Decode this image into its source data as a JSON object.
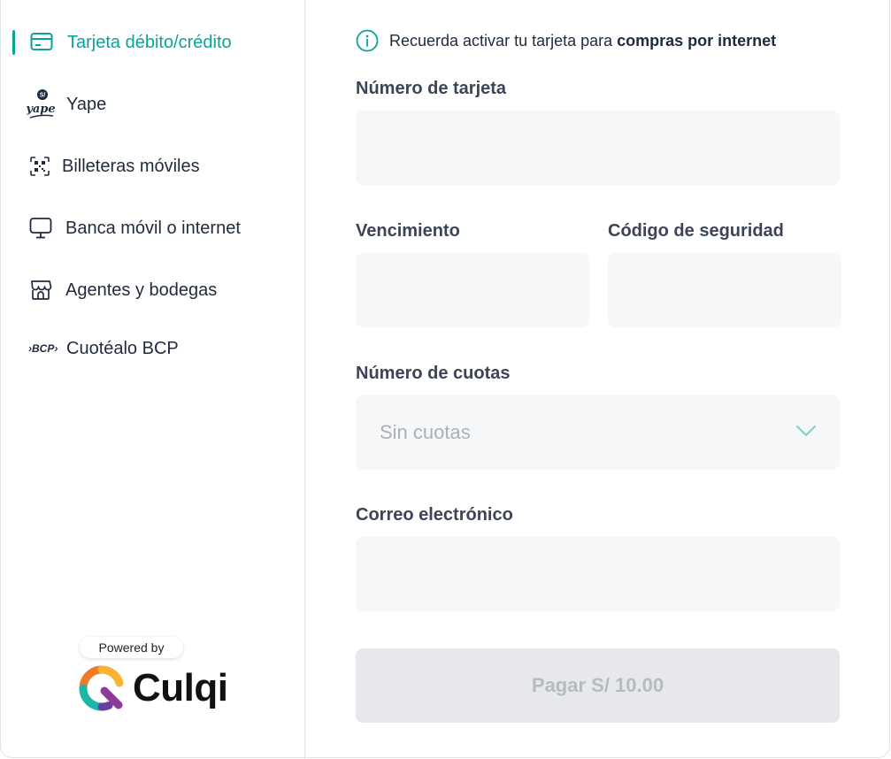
{
  "sidebar": {
    "items": [
      {
        "label": "Tarjeta débito/crédito",
        "icon": "credit-card-icon",
        "active": true
      },
      {
        "label": "Yape",
        "icon": "yape-logo-icon"
      },
      {
        "label": "Billeteras móviles",
        "icon": "qr-code-icon"
      },
      {
        "label": "Banca móvil o internet",
        "icon": "monitor-icon"
      },
      {
        "label": "Agentes y bodegas",
        "icon": "store-icon"
      },
      {
        "label": "Cuotéalo BCP",
        "icon": "bcp-logo-icon",
        "logo_text": "›BCP›"
      }
    ],
    "powered_by": "Powered by",
    "brand": "Culqi"
  },
  "form": {
    "notice_text": "Recuerda activar tu tarjeta para",
    "notice_strong": "compras por internet",
    "card_number_label": "Número de tarjeta",
    "card_number_value": "",
    "expiry_label": "Vencimiento",
    "expiry_value": "",
    "cvv_label": "Código de seguridad",
    "cvv_value": "",
    "installments_label": "Número de cuotas",
    "installments_value": "Sin cuotas",
    "email_label": "Correo electrónico",
    "email_value": "",
    "pay_button": "Pagar S/ 10.00"
  },
  "colors": {
    "accent": "#0aa39a",
    "text": "#1f2b3d",
    "field_bg": "#f6f7f8",
    "button_disabled_bg": "#e6e8eb",
    "button_disabled_text": "#b6bbc2"
  }
}
